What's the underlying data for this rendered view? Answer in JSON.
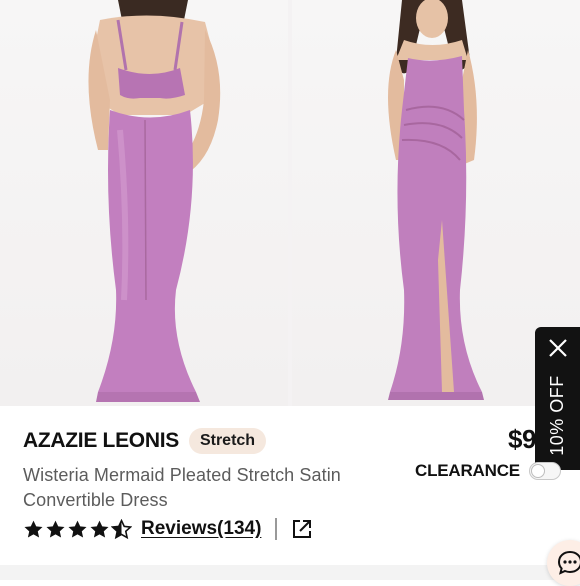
{
  "gallery": {
    "images": [
      {
        "icon": "dress-back-view-photo",
        "dress_color": "#c27fbf"
      },
      {
        "icon": "dress-front-view-photo",
        "dress_color": "#c07fbd"
      }
    ]
  },
  "promo": {
    "label": "10% OFF",
    "close_icon": "close-icon"
  },
  "product": {
    "brand": "AZAZIE LEONIS",
    "badge": "Stretch",
    "title": "Wisteria Mermaid Pleated Stretch Satin Convertible Dress",
    "price": "$9",
    "clearance_label": "CLEARANCE",
    "rating_stars": 4.5,
    "reviews_label": "Reviews(134)"
  },
  "colors": {
    "dress": "#c27fbf",
    "badge_bg": "#f5e8de",
    "promo_bg": "#121212"
  },
  "icons": {
    "share": "external-link-icon",
    "chat": "chat-icon",
    "star": "star-icon"
  }
}
